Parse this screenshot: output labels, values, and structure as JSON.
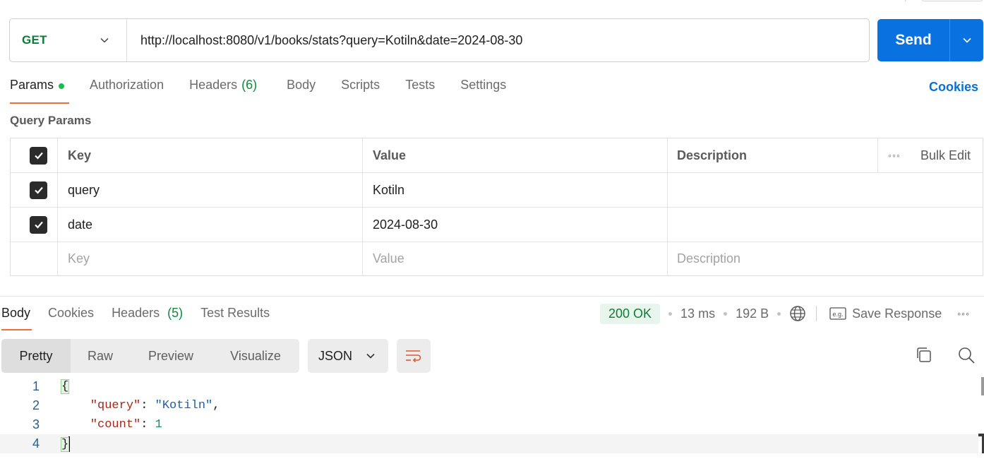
{
  "request": {
    "method": "GET",
    "url": "http://localhost:8080/v1/books/stats?query=Kotiln&date=2024-08-30",
    "send_label": "Send"
  },
  "request_tabs": [
    {
      "label": "Params",
      "active": true,
      "dot": true
    },
    {
      "label": "Authorization"
    },
    {
      "label": "Headers",
      "count": "(6)"
    },
    {
      "label": "Body"
    },
    {
      "label": "Scripts"
    },
    {
      "label": "Tests"
    },
    {
      "label": "Settings"
    }
  ],
  "cookies_link": "Cookies",
  "query_params": {
    "title": "Query Params",
    "headers": {
      "key": "Key",
      "value": "Value",
      "description": "Description",
      "bulk_edit": "Bulk Edit"
    },
    "rows": [
      {
        "checked": true,
        "key": "query",
        "value": "Kotiln",
        "description": ""
      },
      {
        "checked": true,
        "key": "date",
        "value": "2024-08-30",
        "description": ""
      }
    ],
    "placeholder": {
      "key": "Key",
      "value": "Value",
      "description": "Description"
    }
  },
  "response_tabs": [
    {
      "label": "Body",
      "active": true
    },
    {
      "label": "Cookies"
    },
    {
      "label": "Headers",
      "count": "(5)"
    },
    {
      "label": "Test Results"
    }
  ],
  "response_meta": {
    "status": "200 OK",
    "time": "13 ms",
    "size": "192 B",
    "save_label": "Save Response",
    "example_badge": "e.g."
  },
  "view_modes": [
    "Pretty",
    "Raw",
    "Preview",
    "Visualize"
  ],
  "active_view": "Pretty",
  "format": "JSON",
  "code_lines": [
    {
      "n": "1"
    },
    {
      "n": "2",
      "key": "\"query\"",
      "value": "\"Kotiln\""
    },
    {
      "n": "3",
      "key": "\"count\"",
      "value": "1"
    },
    {
      "n": "4"
    }
  ],
  "colors": {
    "accent_tab": "#f26b3a",
    "send_button": "#0a72e0",
    "method_get": "#0d7a3a",
    "status_ok_bg": "#e8f5ec"
  }
}
